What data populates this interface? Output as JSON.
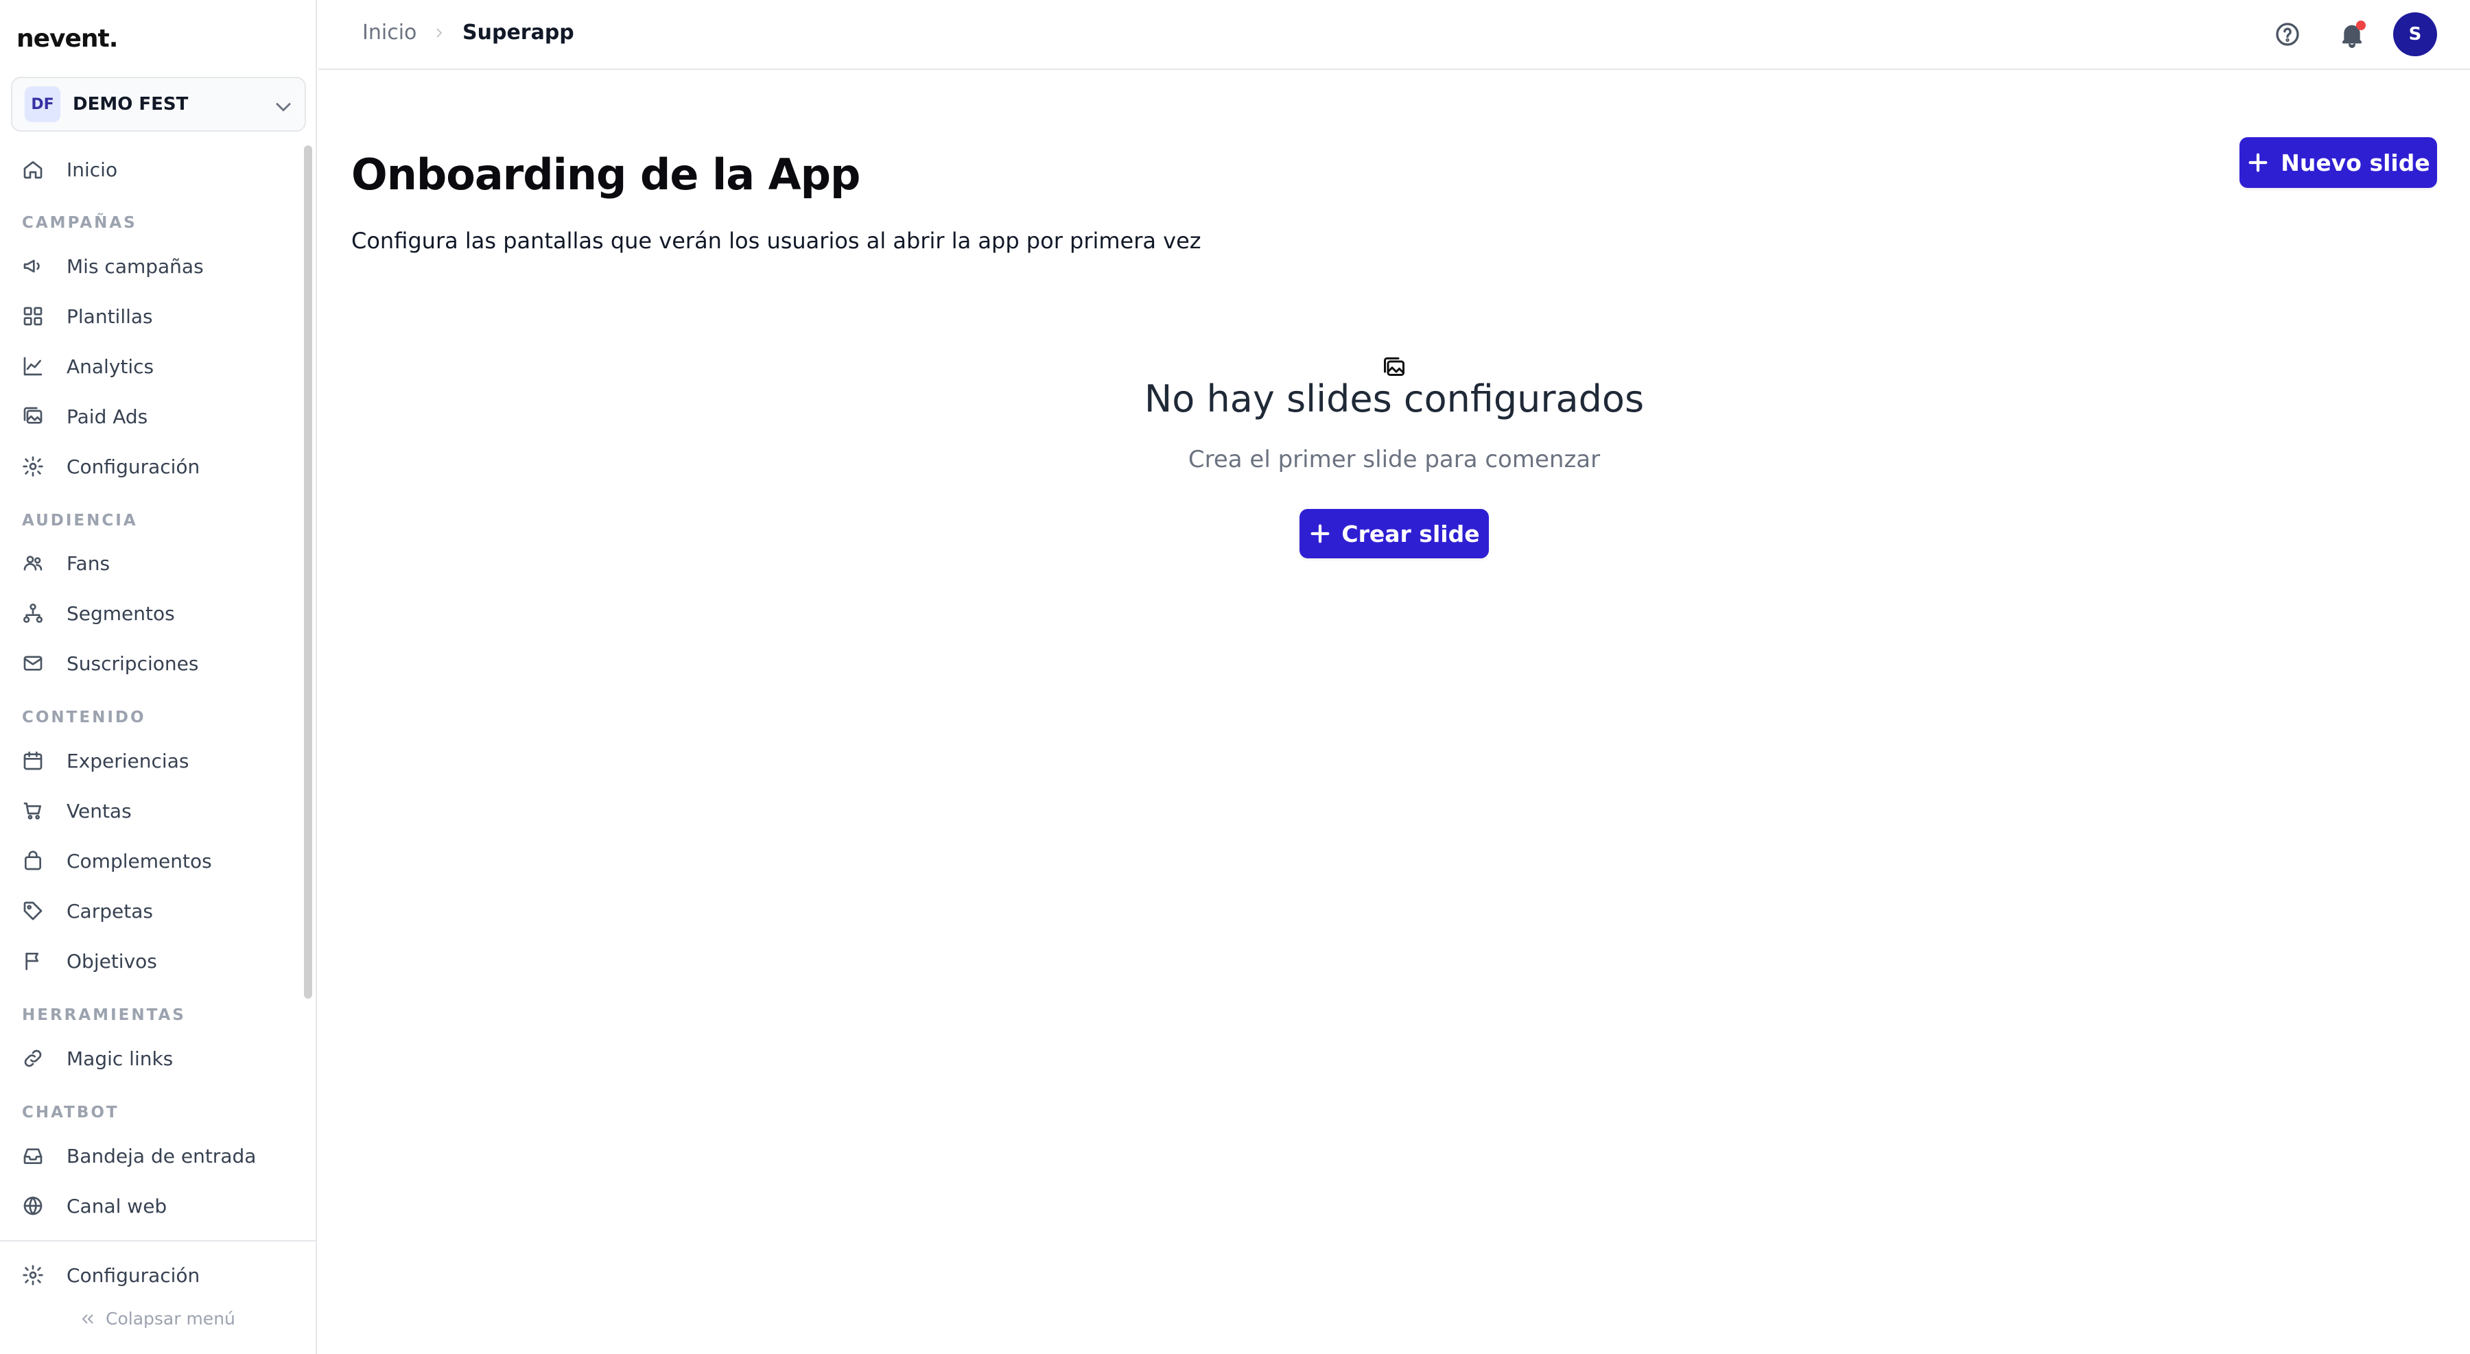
{
  "brand": {
    "logo": "nevent."
  },
  "org": {
    "initials": "DF",
    "name": "DEMO FEST"
  },
  "sidebar": {
    "home": "Inicio",
    "sections": {
      "campaigns": "CAMPAÑAS",
      "audience": "AUDIENCIA",
      "content": "CONTENIDO",
      "tools": "HERRAMIENTAS",
      "chatbot": "CHATBOT"
    },
    "items": {
      "mis_campanas": "Mis campañas",
      "plantillas": "Plantillas",
      "analytics": "Analytics",
      "paid_ads": "Paid Ads",
      "configuracion": "Configuración",
      "fans": "Fans",
      "segmentos": "Segmentos",
      "suscripciones": "Suscripciones",
      "experiencias": "Experiencias",
      "ventas": "Ventas",
      "complementos": "Complementos",
      "carpetas": "Carpetas",
      "objetivos": "Objetivos",
      "magic_links": "Magic links",
      "bandeja": "Bandeja de entrada",
      "canal_web": "Canal web"
    },
    "footer_settings": "Configuración",
    "collapse": "Colapsar menú"
  },
  "header": {
    "breadcrumb": {
      "home": "Inicio",
      "current": "Superapp"
    },
    "user_initial": "S"
  },
  "main": {
    "title": "Onboarding de la App",
    "subtitle": "Configura las pantallas que verán los usuarios al abrir la app por primera vez",
    "new_button": "Nuevo slide",
    "empty": {
      "icon": "images-icon",
      "title": "No hay slides configurados",
      "subtitle": "Crea el primer slide para comenzar",
      "button": "Crear slide"
    }
  },
  "colors": {
    "primary": "#2f1fd3",
    "avatar": "#1e1b9c",
    "notification_dot": "#ef4444"
  }
}
